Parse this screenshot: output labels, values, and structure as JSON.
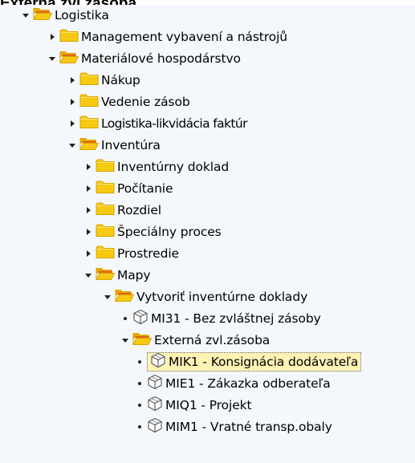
{
  "page": {
    "title": "Externá zvl.zásoba"
  },
  "colors": {
    "folder": "#f6c913",
    "folder_dark": "#d9a400",
    "folder_open": "#e9a900",
    "folder_open_front": "#f6c913",
    "folder_open_line": "#e0541a",
    "tree_background": "#f4f8fc",
    "selection": "#fff2b5"
  },
  "tree": {
    "nodes": [
      {
        "label": "Logistika",
        "toggle": "expanded",
        "icon": "folder-open-icon"
      },
      {
        "label": "Management vybavení a nástrojů",
        "toggle": "collapsed",
        "icon": "folder-icon"
      },
      {
        "label": "Materiálové hospodárstvo",
        "toggle": "expanded",
        "icon": "folder-open-icon"
      },
      {
        "label": "Nákup",
        "toggle": "collapsed",
        "icon": "folder-icon"
      },
      {
        "label": "Vedenie zásob",
        "toggle": "collapsed",
        "icon": "folder-icon"
      },
      {
        "label": "Logistika-likvidácia faktúr",
        "toggle": "collapsed",
        "icon": "folder-icon"
      },
      {
        "label": "Inventúra",
        "toggle": "expanded",
        "icon": "folder-open-icon"
      },
      {
        "label": "Inventúrny doklad",
        "toggle": "collapsed",
        "icon": "folder-icon"
      },
      {
        "label": "Počítanie",
        "toggle": "collapsed",
        "icon": "folder-icon"
      },
      {
        "label": "Rozdiel",
        "toggle": "collapsed",
        "icon": "folder-icon"
      },
      {
        "label": "Špeciálny proces",
        "toggle": "collapsed",
        "icon": "folder-icon"
      },
      {
        "label": "Prostredie",
        "toggle": "collapsed",
        "icon": "folder-icon"
      },
      {
        "label": "Mapy",
        "toggle": "expanded",
        "icon": "folder-open-icon"
      },
      {
        "label": "Vytvoriť inventúrne doklady",
        "toggle": "expanded",
        "icon": "folder-open-icon"
      },
      {
        "label": "MI31 - Bez zvláštnej zásoby",
        "toggle": "leaf",
        "icon": "transaction-cube-icon"
      },
      {
        "label": "Externá zvl.zásoba",
        "toggle": "expanded",
        "icon": "folder-open-icon"
      },
      {
        "label": "MIK1 - Konsignácia dodávateľa",
        "toggle": "leaf",
        "icon": "transaction-cube-icon",
        "selected": true
      },
      {
        "label": "MIE1 - Zákazka odberateľa",
        "toggle": "leaf",
        "icon": "transaction-cube-icon"
      },
      {
        "label": "MIQ1 - Projekt",
        "toggle": "leaf",
        "icon": "transaction-cube-icon"
      },
      {
        "label": "MIM1 - Vratné transp.obaly",
        "toggle": "leaf",
        "icon": "transaction-cube-icon"
      }
    ]
  }
}
